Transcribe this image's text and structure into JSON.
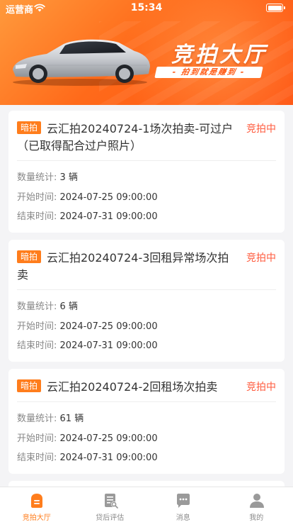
{
  "status_bar": {
    "carrier": "运营商",
    "time": "15:34"
  },
  "banner": {
    "title": "竞拍大厅",
    "slogan": "- 拍到就是赚到 -"
  },
  "auctions": [
    {
      "tag": "暗拍",
      "title": "云汇拍20240724-1场次拍卖-可过户（已取得配合过户照片）",
      "status": "竞拍中",
      "count_label": "数量统计:",
      "count_value": "3 辆",
      "start_label": "开始时间:",
      "start_value": "2024-07-25 09:00:00",
      "end_label": "结束时间:",
      "end_value": "2024-07-31 09:00:00"
    },
    {
      "tag": "暗拍",
      "title": "云汇拍20240724-3回租异常场次拍卖",
      "status": "竞拍中",
      "count_label": "数量统计:",
      "count_value": "6 辆",
      "start_label": "开始时间:",
      "start_value": "2024-07-25 09:00:00",
      "end_label": "结束时间:",
      "end_value": "2024-07-31 09:00:00"
    },
    {
      "tag": "暗拍",
      "title": "云汇拍20240724-2回租场次拍卖",
      "status": "竞拍中",
      "count_label": "数量统计:",
      "count_value": "61 辆",
      "start_label": "开始时间:",
      "start_value": "2024-07-25 09:00:00",
      "end_label": "结束时间:",
      "end_value": "2024-07-31 09:00:00"
    }
  ],
  "tabbar": [
    {
      "label": "竞拍大厅",
      "icon": "auction-hall-icon",
      "active": true
    },
    {
      "label": "贷后评估",
      "icon": "evaluation-doc-icon",
      "active": false
    },
    {
      "label": "消息",
      "icon": "message-bubble-icon",
      "active": false
    },
    {
      "label": "我的",
      "icon": "user-profile-icon",
      "active": false
    }
  ],
  "colors": {
    "accent": "#ff7d1c",
    "status_red": "#ff5a3c",
    "banner_orange": "#ff6a1a"
  }
}
